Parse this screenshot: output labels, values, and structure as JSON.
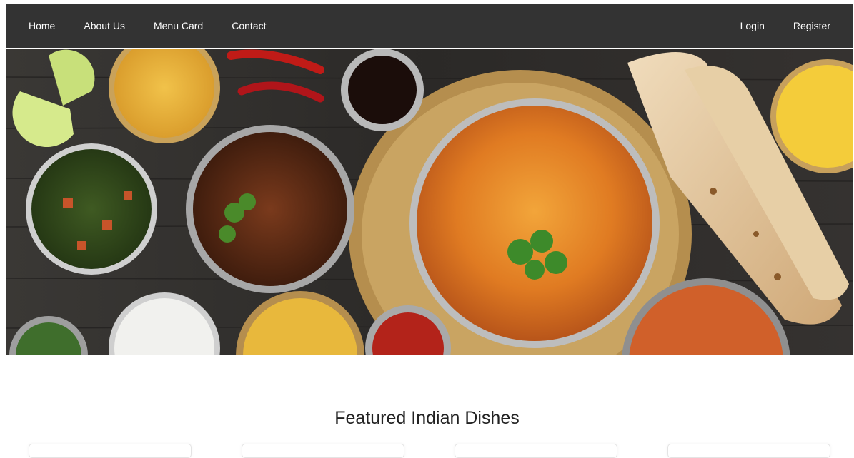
{
  "navbar": {
    "left_links": [
      "Home",
      "About Us",
      "Menu Card",
      "Contact"
    ],
    "right_links": [
      "Login",
      "Register"
    ]
  },
  "hero": {
    "carousel_slides": 3,
    "active_slide": 1
  },
  "featured": {
    "title": "Featured Indian Dishes",
    "card_count": 4
  }
}
